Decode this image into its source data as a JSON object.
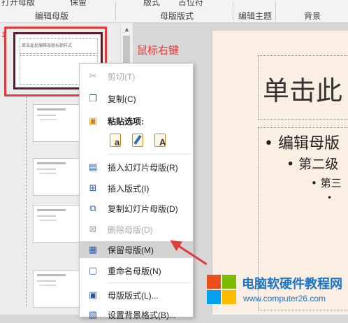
{
  "ribbon": {
    "top_fragments": [
      "打开母版",
      "保留",
      "版式",
      "占位符"
    ],
    "groups": [
      "编辑母版",
      "母版版式",
      "编辑主题",
      "背景"
    ]
  },
  "thumbnails": {
    "slide_number": "1",
    "master_title": "单击此处编辑母版标题样式"
  },
  "annotation": "鼠标右键",
  "slide": {
    "title": "单击此",
    "levels": [
      "• 编辑母版",
      "• 第二级",
      "• 第三",
      "•"
    ]
  },
  "context_menu": {
    "items": [
      {
        "icon": "scissors-icon",
        "label": "剪切(T)",
        "disabled": true
      },
      {
        "icon": "copy-icon",
        "label": "复制(C)",
        "disabled": false
      },
      {
        "icon": "clipboard-icon",
        "label": "粘贴选项:",
        "disabled": false
      },
      {
        "icon": "insert-master-icon",
        "label": "插入幻灯片母版(R)",
        "disabled": false
      },
      {
        "icon": "insert-layout-icon",
        "label": "插入版式(I)",
        "disabled": false
      },
      {
        "icon": "duplicate-master-icon",
        "label": "复制幻灯片母版(D)",
        "disabled": false
      },
      {
        "icon": "delete-master-icon",
        "label": "删除母版(D)",
        "disabled": true
      },
      {
        "icon": "preserve-master-icon",
        "label": "保留母版(M)",
        "disabled": false
      },
      {
        "icon": "rename-master-icon",
        "label": "重命名母版(N)",
        "disabled": false
      },
      {
        "icon": "master-layout-icon",
        "label": "母版版式(L)...",
        "disabled": false
      },
      {
        "icon": "background-format-icon",
        "label": "设置背景格式(B)...",
        "disabled": false
      }
    ],
    "paste_buttons": [
      "a",
      "",
      "A"
    ]
  },
  "watermark": {
    "title": "电脑软硬件教程网",
    "url": "www.computer26.com"
  },
  "colors": {
    "highlight": "#e23b3b",
    "menu_hover": "#d3d3d3",
    "slide_bg": "#fbeee3",
    "watermark_blue": "#1a74c9"
  }
}
